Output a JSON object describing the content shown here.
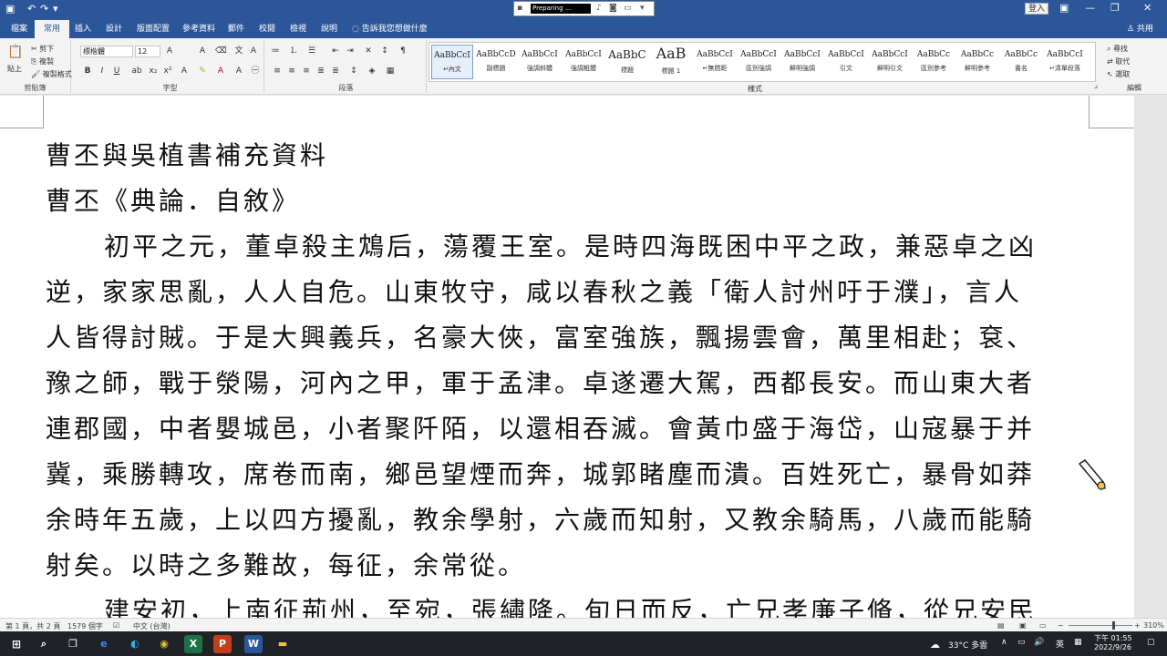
{
  "titlebar": {
    "preparing_label": "Preparing ...",
    "login_label": "登入"
  },
  "ribbon_tabs": [
    "檔案",
    "常用",
    "插入",
    "設計",
    "版面配置",
    "參考資料",
    "郵件",
    "校閱",
    "檢視",
    "說明"
  ],
  "tell_me": "告訴我您想做什麼",
  "share_label": "共用",
  "clipboard": {
    "paste": "貼上",
    "cut": "剪下",
    "copy": "複製",
    "format_painter": "複製格式",
    "group_label": "剪貼簿"
  },
  "font": {
    "name": "標楷體",
    "size": "12",
    "group_label": "字型"
  },
  "paragraph": {
    "group_label": "段落"
  },
  "styles": {
    "group_label": "樣式",
    "items": [
      {
        "sample": "AaBbCcI",
        "name": "↵內文"
      },
      {
        "sample": "AaBbCcD",
        "name": "副標題"
      },
      {
        "sample": "AaBbCcI",
        "name": "強調斜體"
      },
      {
        "sample": "AaBbCcI",
        "name": "強調粗體"
      },
      {
        "sample": "AaBbC",
        "name": "標題"
      },
      {
        "sample": "AaB",
        "name": "標題 1"
      },
      {
        "sample": "AaBbCcI",
        "name": "↵無間距"
      },
      {
        "sample": "AaBbCcI",
        "name": "區別強調"
      },
      {
        "sample": "AaBbCcI",
        "name": "鮮明強調"
      },
      {
        "sample": "AaBbCcI",
        "name": "引文"
      },
      {
        "sample": "AaBbCcI",
        "name": "鮮明引文"
      },
      {
        "sample": "AaBbCc",
        "name": "區別參考"
      },
      {
        "sample": "AaBbCc",
        "name": "鮮明參考"
      },
      {
        "sample": "AaBbCc",
        "name": "書名"
      },
      {
        "sample": "AaBbCcI",
        "name": "↵清單段落"
      }
    ]
  },
  "editing": {
    "find": "尋找",
    "replace": "取代",
    "select": "選取",
    "group_label": "編輯"
  },
  "document": {
    "lines": [
      "曹丕與吳植書補充資料",
      "曹丕《典論．自敘》",
      "初平之元，董卓殺主鴆后，蕩覆王室。是時四海既困中平之政，兼惡卓之凶",
      "逆，家家思亂，人人自危。山東牧守，咸以春秋之義「衛人討州吁于濮」，言人",
      "人皆得討賊。于是大興義兵，名豪大俠，富室強族，飄揚雲會，萬里相赴；袞、",
      "豫之師，戰于滎陽，河內之甲，軍于孟津。卓遂遷大駕，西都長安。而山東大者",
      "連郡國，中者嬰城邑，小者聚阡陌，以還相吞滅。會黃巾盛于海岱，山寇暴于并",
      "冀，乘勝轉攻，席卷而南，鄉邑望煙而奔，城郭睹塵而潰。百姓死亡，暴骨如莽",
      "余時年五歲，上以四方擾亂，教余學射，六歲而知射，又教余騎馬，八歲而能騎",
      "射矣。以時之多難故，每征，余常從。",
      "建安初，上南征荊州，至宛，張繡降。旬日而反，亡兄孝廉子脩，從兄安民"
    ]
  },
  "statusbar": {
    "page": "第 1 頁，共 2 頁",
    "words": "1579 個字",
    "language": "中文 (台灣)",
    "zoom": "310%"
  },
  "taskbar": {
    "weather": "33°C 多雲",
    "ime": "英",
    "time": "下午 01:55",
    "date": "2022/9/26"
  }
}
